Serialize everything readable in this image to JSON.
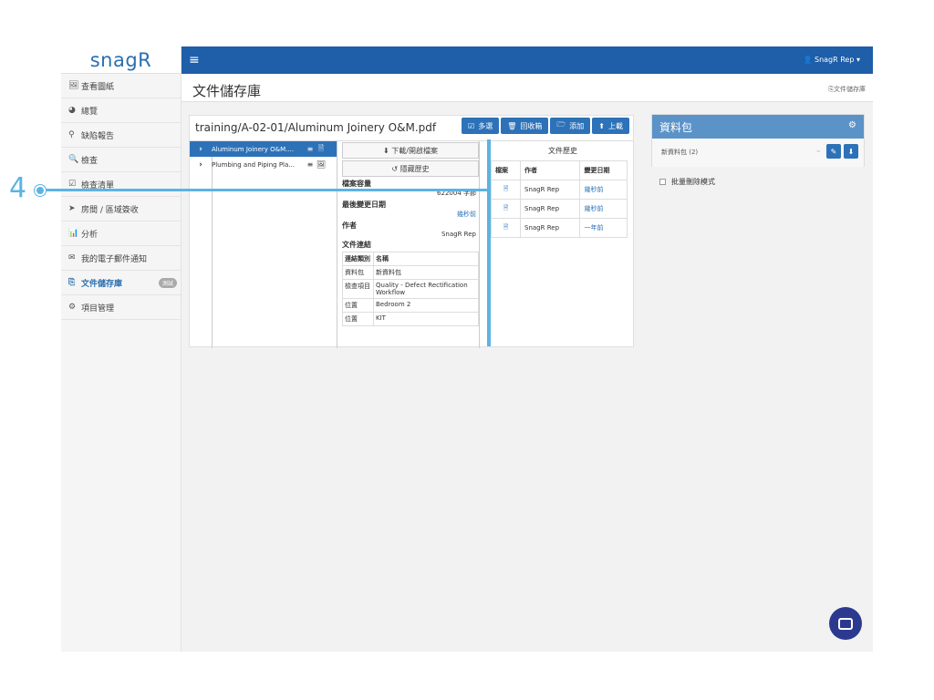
{
  "callout": {
    "number": "4"
  },
  "sidebar": {
    "logo": "snagR",
    "items": [
      {
        "icon": "🖼",
        "label": "查看圖紙"
      },
      {
        "icon": "◕",
        "label": "總覽"
      },
      {
        "icon": "⚲",
        "label": "缺陷報告"
      },
      {
        "icon": "🔍",
        "label": "檢查"
      },
      {
        "icon": "☑",
        "label": "檢查清單"
      },
      {
        "icon": "➤",
        "label": "房間 / 區域簽收"
      },
      {
        "icon": "📊",
        "label": "分析"
      },
      {
        "icon": "✉",
        "label": "我的電子郵件通知"
      },
      {
        "icon": "⎘",
        "label": "文件儲存庫",
        "badge": "測試"
      },
      {
        "icon": "⚙",
        "label": "項目管理"
      }
    ]
  },
  "topbar": {
    "menu_icon": "≡",
    "user": "👤 SnagR Rep ▾"
  },
  "page": {
    "title": "文件儲存庫",
    "breadcrumb": "⎘文件儲存庫"
  },
  "document": {
    "path": "training/A-02-01/Aluminum Joinery O&M.pdf",
    "buttons": [
      {
        "icon": "☑",
        "label": "多選"
      },
      {
        "icon": "🗑",
        "label": "回收箱"
      },
      {
        "icon": "🗁",
        "label": "添加"
      },
      {
        "icon": "⬆",
        "label": "上載"
      }
    ],
    "files": [
      {
        "name": "Aluminum Joinery O&M....",
        "menu_icon": "≡",
        "type_icon": "🗎",
        "selected": true
      },
      {
        "name": "Plumbing and Piping Pla...",
        "menu_icon": "≡",
        "type_icon": "🖼",
        "selected": false
      }
    ],
    "detail": {
      "download_btn": "⬇ 下載/開啟檔案",
      "history_btn": "↺ 隱藏歷史",
      "size_label": "檔案容量",
      "size_value": "622004 字節",
      "modified_label": "最後變更日期",
      "modified_value": "幾秒前",
      "author_label": "作者",
      "author_value": "SnagR Rep",
      "links_label": "文件連結",
      "links_headers": [
        "連結類別",
        "名稱"
      ],
      "links": [
        {
          "type": "資料包",
          "name": "新資料包"
        },
        {
          "type": "檢查項目",
          "name": "Quality - Defect Rectification Workflow"
        },
        {
          "type": "位置",
          "name": "Bedroom 2"
        },
        {
          "type": "位置",
          "name": "KIT"
        }
      ]
    },
    "history": {
      "title": "文件歷史",
      "headers": [
        "檔案",
        "作者",
        "變更日期"
      ],
      "rows": [
        {
          "author": "SnagR Rep",
          "date": "幾秒前"
        },
        {
          "author": "SnagR Rep",
          "date": "幾秒前"
        },
        {
          "author": "SnagR Rep",
          "date": "一年前"
        }
      ]
    }
  },
  "package_panel": {
    "title": "資料包",
    "gear_icon": "⚙",
    "package_name": "新資料包 (2)",
    "batch_delete_label": "批量刪除模式"
  }
}
